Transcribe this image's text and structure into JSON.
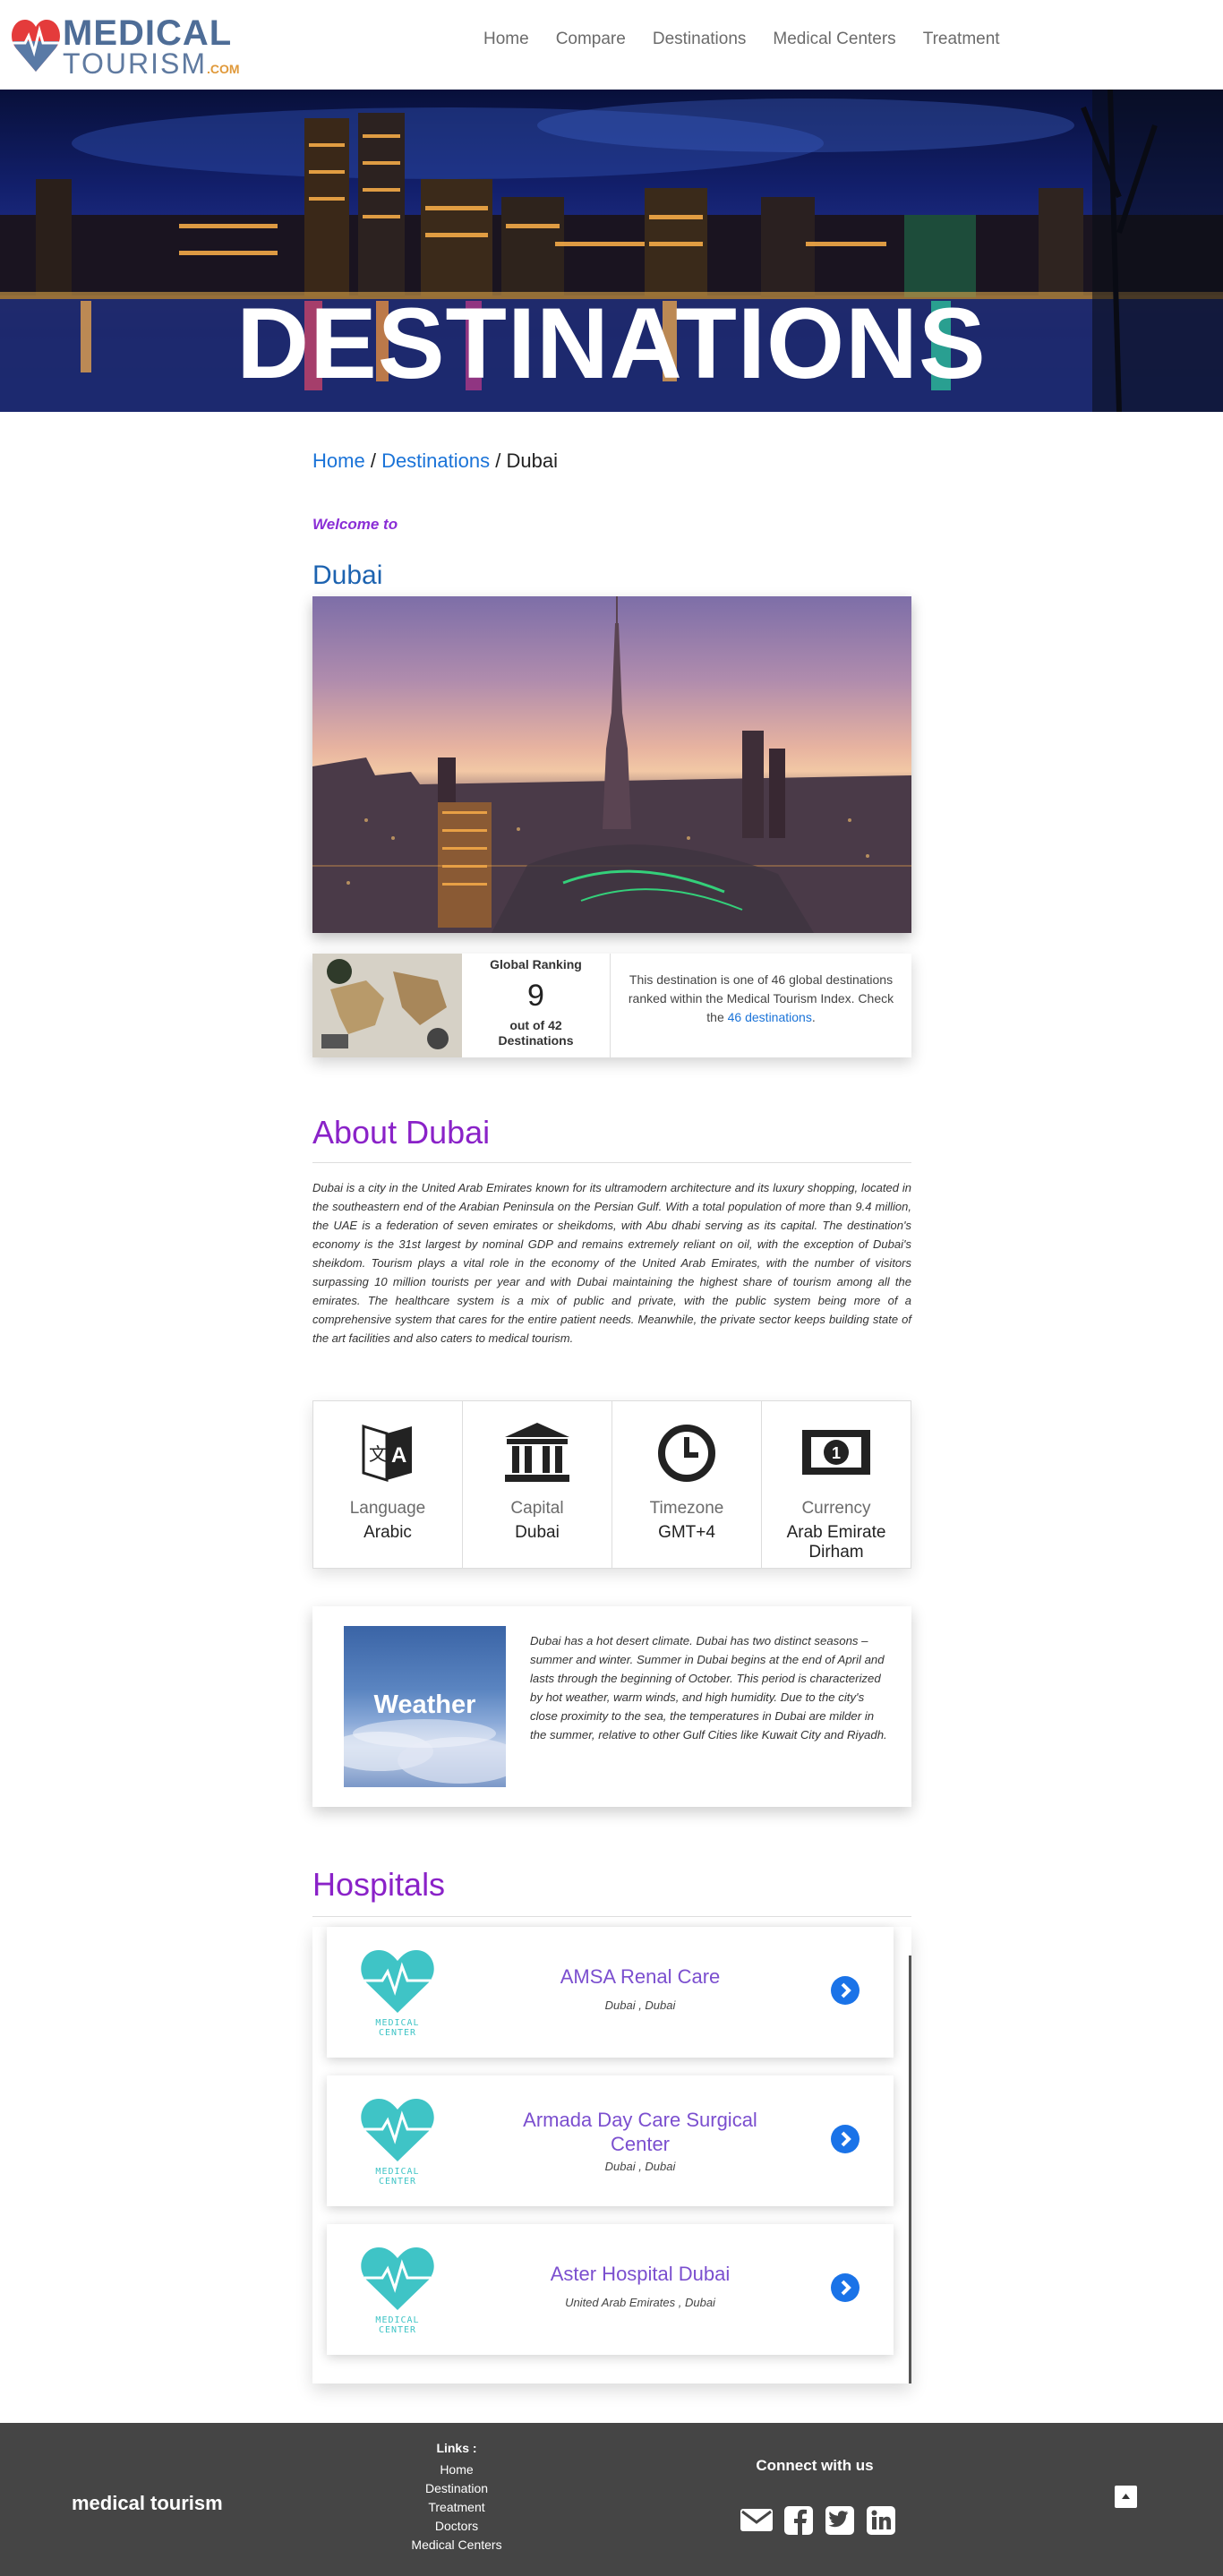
{
  "header": {
    "logo": {
      "word1": "MEDICAL",
      "word2": "TOURISM",
      "suffix": ".COM"
    },
    "nav": [
      "Home",
      "Compare",
      "Destinations",
      "Medical Centers",
      "Treatment"
    ]
  },
  "hero": {
    "title": "DESTINATIONS"
  },
  "breadcrumb": {
    "home": "Home",
    "destinations": "Destinations",
    "current": "Dubai",
    "separator": "/"
  },
  "welcome": "Welcome to",
  "city": "Dubai",
  "ranking": {
    "label": "Global Ranking",
    "value": "9",
    "out_of": "out of 42",
    "unit": "Destinations",
    "desc_before": "This destination is one of 46 global destinations ranked within the Medical Tourism Index. Check the ",
    "desc_link": "46 destinations",
    "desc_after": "."
  },
  "about": {
    "title": "About Dubai",
    "text": "Dubai is a city in the United Arab Emirates known for its ultramodern architecture and its luxury shopping, located in the southeastern end of the Arabian Peninsula on the Persian Gulf. With a total population of more than 9.4 million, the UAE is a federation of seven emirates or sheikdoms, with Abu dhabi serving as its capital. The destination's economy is the 31st largest by nominal GDP and remains extremely reliant on oil, with the exception of Dubai's sheikdom. Tourism plays a vital role in the economy of the United Arab Emirates, with the number of visitors surpassing 10 million tourists per year and with Dubai maintaining the highest share of tourism among all the emirates. The healthcare system is a mix of public and private, with the public system being more of a comprehensive system that cares for the entire patient needs. Meanwhile, the private sector keeps building state of the art facilities and also caters to medical tourism."
  },
  "facts": [
    {
      "icon": "language-icon",
      "label": "Language",
      "value": "Arabic"
    },
    {
      "icon": "bank-icon",
      "label": "Capital",
      "value": "Dubai"
    },
    {
      "icon": "clock-icon",
      "label": "Timezone",
      "value": "GMT+4"
    },
    {
      "icon": "money-icon",
      "label": "Currency",
      "value": "Arab Emirate Dirham"
    }
  ],
  "weather": {
    "image_label": "Weather",
    "text": "Dubai has a hot desert climate. Dubai has two distinct seasons – summer and winter. Summer in Dubai begins at the end of April and lasts through the beginning of October. This period is characterized by hot weather, warm winds, and high humidity. Due to the city's close proximity to the sea, the temperatures in Dubai are milder in the summer, relative to other Gulf Cities like Kuwait City and Riyadh."
  },
  "hospitals": {
    "title": "Hospitals",
    "logo_text": [
      "MEDICAL",
      "CENTER"
    ],
    "items": [
      {
        "name": "AMSA Renal Care",
        "location": "Dubai , Dubai"
      },
      {
        "name": "Armada Day Care Surgical Center",
        "location": "Dubai , Dubai"
      },
      {
        "name": "Aster Hospital Dubai",
        "location": "United Arab Emirates , Dubai"
      }
    ]
  },
  "footer": {
    "brand": "medical tourism",
    "links_title": "Links :",
    "links": [
      "Home",
      "Destination",
      "Treatment",
      "Doctors",
      "Medical Centers"
    ],
    "connect": "Connect with us",
    "social": [
      "envelope-icon",
      "facebook-icon",
      "twitter-icon",
      "linkedin-icon"
    ]
  },
  "colors": {
    "brand_blue": "#4e6d97",
    "accent_purple": "#8a22c8",
    "link_blue": "#1a73d8",
    "hospital_teal": "#3fc4c6",
    "footer_bg": "#454545"
  }
}
